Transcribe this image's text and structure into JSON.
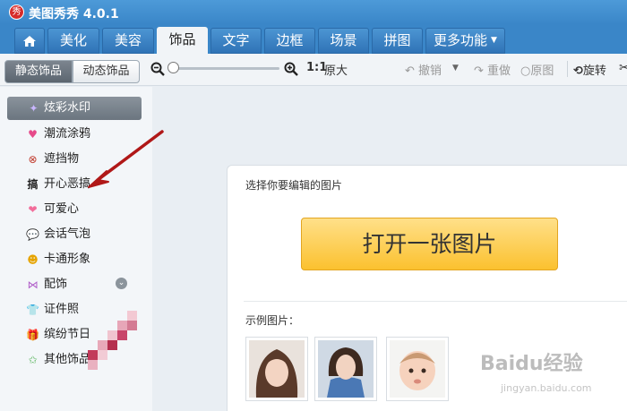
{
  "window": {
    "logo_text": "秀",
    "title": "美图秀秀 4.0.1"
  },
  "tabs": [
    {
      "label": ""
    },
    {
      "label": "美化"
    },
    {
      "label": "美容"
    },
    {
      "label": "饰品"
    },
    {
      "label": "文字"
    },
    {
      "label": "边框"
    },
    {
      "label": "场景"
    },
    {
      "label": "拼图"
    },
    {
      "label": "更多功能"
    }
  ],
  "active_tab": "饰品",
  "subtabs": {
    "static": "静态饰品",
    "dynamic": "动态饰品"
  },
  "toolbar": {
    "ratio_label": "1:1",
    "original_size": "原大",
    "undo": "撤销",
    "redo": "重做",
    "original": "原图",
    "rotate": "旋转"
  },
  "sidebar": {
    "items": [
      {
        "label": "炫彩水印",
        "icon": "sparkle-icon"
      },
      {
        "label": "潮流涂鸦",
        "icon": "lips-icon"
      },
      {
        "label": "遮挡物",
        "icon": "mask-icon"
      },
      {
        "label": "开心恶搞",
        "icon": "prank-icon"
      },
      {
        "label": "可爱心",
        "icon": "heart-icon"
      },
      {
        "label": "会话气泡",
        "icon": "speech-bubble-icon"
      },
      {
        "label": "卡通形象",
        "icon": "cartoon-icon"
      },
      {
        "label": "配饰",
        "icon": "bow-icon"
      },
      {
        "label": "证件照",
        "icon": "shirt-icon"
      },
      {
        "label": "缤纷节日",
        "icon": "gift-icon"
      },
      {
        "label": "其他饰品",
        "icon": "star-icon"
      }
    ]
  },
  "prank_glyph": "搞",
  "main": {
    "prompt": "选择你要编辑的图片",
    "open_button": "打开一张图片",
    "sample_label": "示例图片："
  },
  "watermark": {
    "brand": "Baidu经验",
    "url": "jingyan.baidu.com"
  },
  "colors": {
    "title_bar": "#3a86c8",
    "open_button": "#fbc12f",
    "annotation_arrow": "#b01818"
  }
}
